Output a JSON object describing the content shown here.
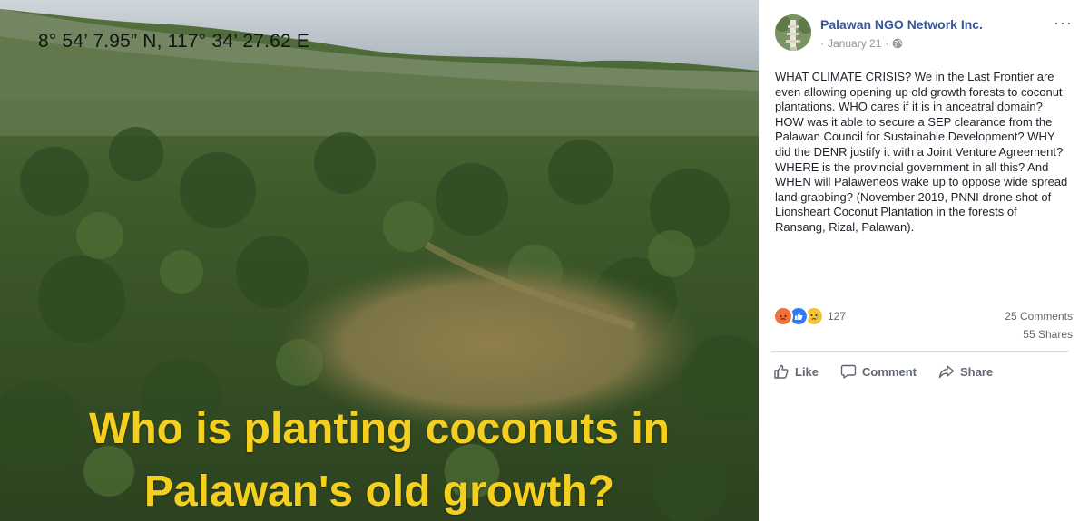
{
  "photo": {
    "coordinates_text": "8° 54’ 7.95” N, 117° 34’ 27.62 E",
    "headline_line1": "Who is planting coconuts in",
    "headline_line2": "Palawan's old growth?",
    "headline_color": "#f5cf1e"
  },
  "post": {
    "page_name": "Palawan NGO Network Inc.",
    "date": "January 21",
    "separator": "·",
    "privacy_icon": "globe-icon",
    "more_icon": "ellipsis-icon",
    "more_label": "···",
    "text": "WHAT CLIMATE CRISIS? We in the Last Frontier are even allowing opening up old growth forests to coconut plantations. WHO cares if it is in anceatral domain? HOW was it able to secure a SEP clearance from the Palawan Council for Sustainable Development? WHY did the DENR justify it with a Joint Venture Agreement? WHERE is the provincial government in all this? And WHEN will Palaweneos wake up to oppose wide spread land grabbing? (November 2019, PNNI drone shot of Lionsheart Coconut Plantation in the forests of Ransang, Rizal, Palawan).",
    "reactions": {
      "icons": [
        "angry-reaction-icon",
        "like-reaction-icon",
        "sad-reaction-icon"
      ],
      "count": "127"
    },
    "comments_count": "25 Comments",
    "shares_count": "55 Shares",
    "actions": {
      "like": "Like",
      "comment": "Comment",
      "share": "Share"
    },
    "link_color": "#365899"
  }
}
